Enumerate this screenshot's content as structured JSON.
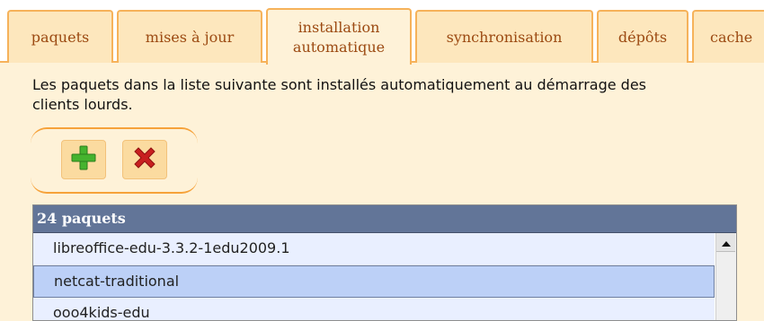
{
  "tabs": [
    {
      "label": "paquets"
    },
    {
      "label": "mises à jour"
    },
    {
      "label": "installation automatique",
      "line1": "installation",
      "line2": "automatique",
      "active": true
    },
    {
      "label": "synchronisation"
    },
    {
      "label": "dépôts"
    },
    {
      "label": "cache"
    }
  ],
  "description": "Les paquets dans la liste suivante sont installés automatiquement au démarrage des clients lourds.",
  "toolbar": {
    "add_icon": "plus-icon",
    "remove_icon": "cross-icon"
  },
  "list": {
    "header": "24 paquets",
    "items": [
      {
        "label": "libreoffice-edu-3.3.2-1edu2009.1",
        "selected": false
      },
      {
        "label": "netcat-traditional",
        "selected": true
      },
      {
        "label": "ooo4kids-edu",
        "selected": false
      }
    ]
  },
  "colors": {
    "tab_bg": "#fde7bd",
    "tab_border": "#f6b25a",
    "tab_text": "#9c4a12",
    "panel_bg": "#fef2d8",
    "list_header_bg": "#627598",
    "row_bg": "#e9efff",
    "row_selected_bg": "#bcd0f7",
    "add_green": "#45b32e",
    "remove_red": "#c81f1f"
  }
}
